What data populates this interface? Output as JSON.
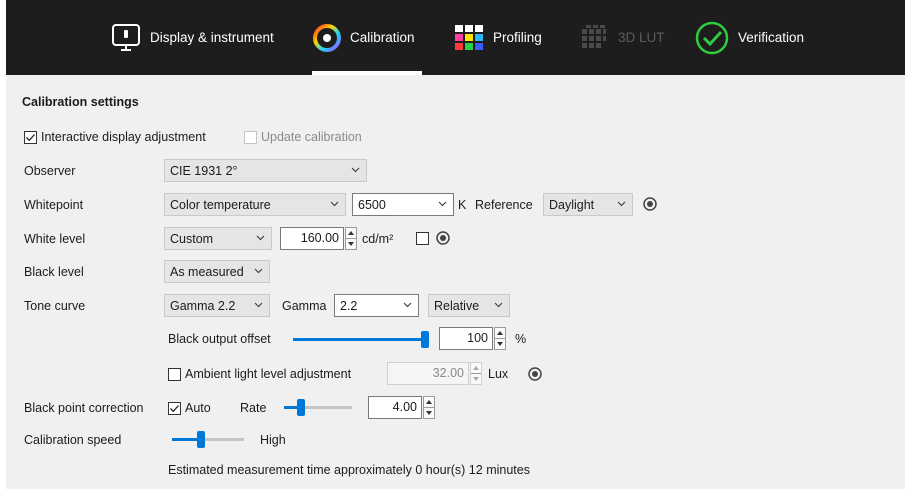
{
  "tabs": [
    {
      "label": "Display & instrument",
      "icon": "display-icon",
      "state": "normal"
    },
    {
      "label": "Calibration",
      "icon": "calibration-icon",
      "state": "active"
    },
    {
      "label": "Profiling",
      "icon": "profiling-icon",
      "state": "normal"
    },
    {
      "label": "3D LUT",
      "icon": "3dlut-icon",
      "state": "disabled"
    },
    {
      "label": "Verification",
      "icon": "verification-icon",
      "state": "normal"
    }
  ],
  "section_title": "Calibration settings",
  "interactive_adjustment": {
    "label": "Interactive display adjustment",
    "checked": true
  },
  "update_calibration": {
    "label": "Update calibration",
    "checked": false,
    "enabled": false
  },
  "observer": {
    "label": "Observer",
    "value": "CIE 1931 2°"
  },
  "whitepoint": {
    "label": "Whitepoint",
    "mode": "Color temperature",
    "value": "6500",
    "unit": "K",
    "reference_label": "Reference",
    "reference_value": "Daylight"
  },
  "white_level": {
    "label": "White level",
    "mode": "Custom",
    "value": "160.00",
    "unit": "cd/m²",
    "checked": false
  },
  "black_level": {
    "label": "Black level",
    "mode": "As measured"
  },
  "tone_curve": {
    "label": "Tone curve",
    "mode": "Gamma 2.2",
    "gamma_label": "Gamma",
    "gamma_value": "2.2",
    "type": "Relative"
  },
  "black_output_offset": {
    "label": "Black output offset",
    "value": "100",
    "unit": "%",
    "slider_fraction": 1.0
  },
  "ambient": {
    "label": "Ambient light level adjustment",
    "checked": false,
    "value": "32.00",
    "unit": "Lux"
  },
  "black_point_correction": {
    "label": "Black point correction",
    "auto_label": "Auto",
    "auto_checked": true,
    "rate_label": "Rate",
    "rate_value": "4.00",
    "slider_fraction": 0.25
  },
  "calibration_speed": {
    "label": "Calibration speed",
    "value": "High",
    "slider_fraction": 0.4
  },
  "estimate": "Estimated measurement time approximately 0 hour(s) 12 minutes",
  "colors": {
    "accent": "#0078d7",
    "topbar": "#1d1d1d",
    "panel": "#f0f0f0",
    "verify_green": "#2ecc40"
  }
}
